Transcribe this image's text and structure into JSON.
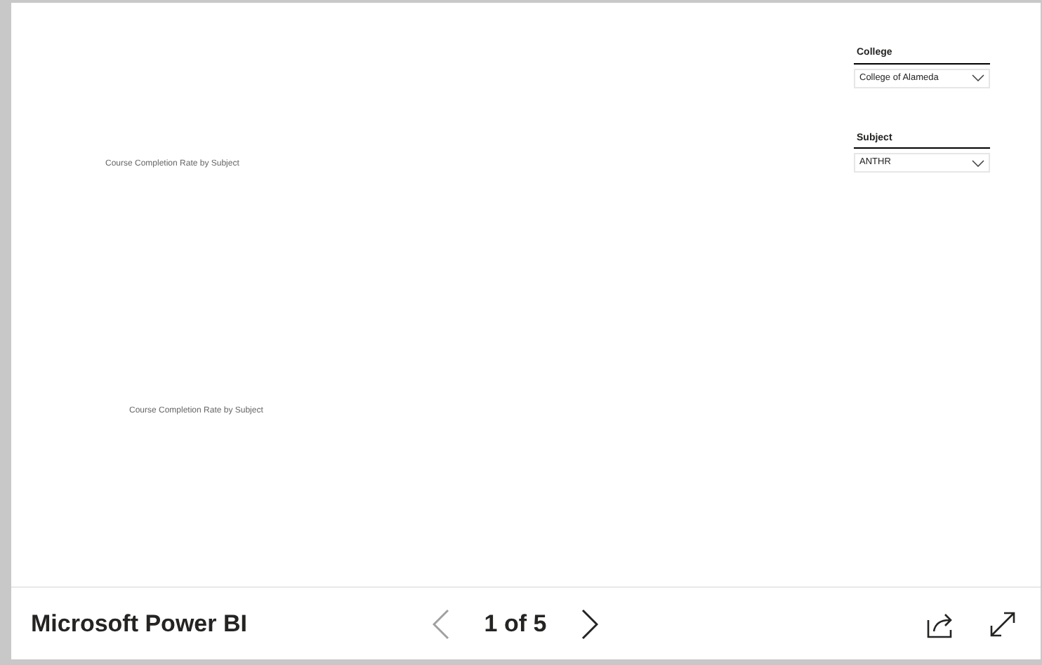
{
  "report": {
    "visuals": [
      {
        "title": "Course Completion Rate by Subject"
      },
      {
        "title": "Course Completion Rate by Subject"
      }
    ],
    "slicers": [
      {
        "title": "College",
        "value": "College of Alameda"
      },
      {
        "title": "Subject",
        "value": "ANTHR"
      }
    ]
  },
  "footer": {
    "brand": "Microsoft Power BI",
    "page_indicator": "1 of 5",
    "prev": {
      "disabled": true
    },
    "next": {
      "disabled": false
    }
  }
}
